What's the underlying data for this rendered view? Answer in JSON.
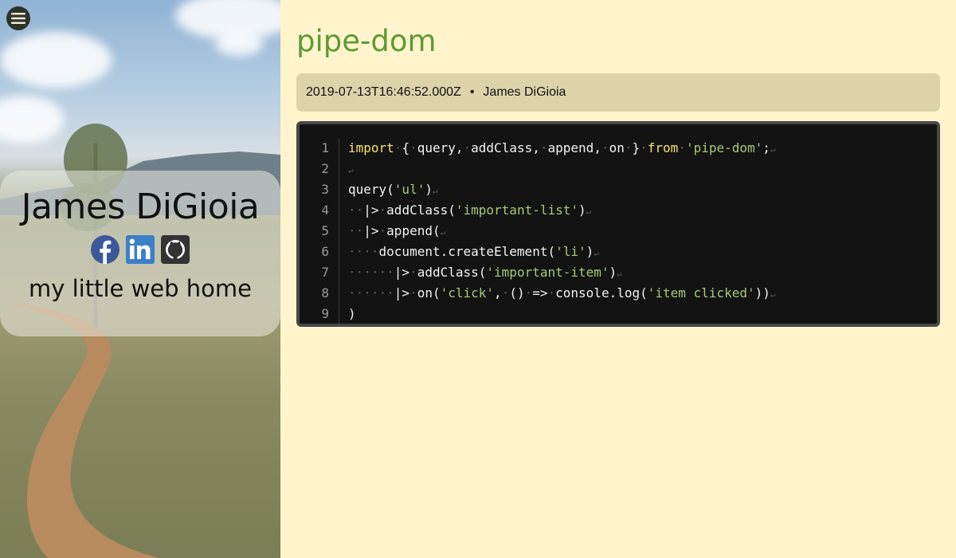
{
  "sidebar": {
    "menu_icon": "hamburger-icon",
    "name": "James DiGioia",
    "tagline": "my little web home",
    "social": [
      {
        "name": "facebook",
        "icon": "facebook-icon",
        "color": "#3b5998"
      },
      {
        "name": "linkedin",
        "icon": "linkedin-icon",
        "color": "#3d7fc7"
      },
      {
        "name": "github",
        "icon": "github-icon",
        "color": "#333333"
      }
    ]
  },
  "post": {
    "title": "pipe-dom",
    "date": "2019-07-13T16:46:52.000Z",
    "separator": "•",
    "author": "James DiGioia",
    "code": {
      "line_numbers": [
        "1",
        "2",
        "3",
        "4",
        "5",
        "6",
        "7",
        "8",
        "9"
      ],
      "lines": [
        [
          [
            "kw",
            "import"
          ],
          [
            "ws",
            "·"
          ],
          [
            "p",
            "{"
          ],
          [
            "ws",
            "·"
          ],
          [
            "p",
            "query,"
          ],
          [
            "ws",
            "·"
          ],
          [
            "p",
            "addClass,"
          ],
          [
            "ws",
            "·"
          ],
          [
            "p",
            "append,"
          ],
          [
            "ws",
            "·"
          ],
          [
            "p",
            "on"
          ],
          [
            "ws",
            "·"
          ],
          [
            "p",
            "}"
          ],
          [
            "ws",
            "·"
          ],
          [
            "kw",
            "from"
          ],
          [
            "ws",
            "·"
          ],
          [
            "str",
            "'pipe-dom'"
          ],
          [
            "p",
            ";"
          ]
        ],
        [],
        [
          [
            "p",
            "query("
          ],
          [
            "str",
            "'ul'"
          ],
          [
            "p",
            ")"
          ]
        ],
        [
          [
            "ws",
            "··"
          ],
          [
            "p",
            "|>"
          ],
          [
            "ws",
            "·"
          ],
          [
            "p",
            "addClass("
          ],
          [
            "str",
            "'important-list'"
          ],
          [
            "p",
            ")"
          ]
        ],
        [
          [
            "ws",
            "··"
          ],
          [
            "p",
            "|>"
          ],
          [
            "ws",
            "·"
          ],
          [
            "p",
            "append("
          ]
        ],
        [
          [
            "ws",
            "····"
          ],
          [
            "p",
            "document.createElement("
          ],
          [
            "str",
            "'li'"
          ],
          [
            "p",
            ")"
          ]
        ],
        [
          [
            "ws",
            "······"
          ],
          [
            "p",
            "|>"
          ],
          [
            "ws",
            "·"
          ],
          [
            "p",
            "addClass("
          ],
          [
            "str",
            "'important-item'"
          ],
          [
            "p",
            ")"
          ]
        ],
        [
          [
            "ws",
            "······"
          ],
          [
            "p",
            "|>"
          ],
          [
            "ws",
            "·"
          ],
          [
            "p",
            "on("
          ],
          [
            "str",
            "'click'"
          ],
          [
            "p",
            ","
          ],
          [
            "ws",
            "·"
          ],
          [
            "p",
            "()"
          ],
          [
            "ws",
            "·"
          ],
          [
            "p",
            "=>"
          ],
          [
            "ws",
            "·"
          ],
          [
            "p",
            "console.log("
          ],
          [
            "str",
            "'item clicked'"
          ],
          [
            "p",
            "))"
          ]
        ],
        [
          [
            "p",
            ")"
          ]
        ]
      ],
      "eol_marker": "↵",
      "colors": {
        "keyword": "#f6e36b",
        "string": "#a8c97a",
        "whitespace": "#5d5d5d"
      }
    }
  },
  "theme": {
    "background": "#fff4cc",
    "title_color": "#5f9a36",
    "meta_bg": "#ddd3ab",
    "code_bg": "#131313"
  }
}
